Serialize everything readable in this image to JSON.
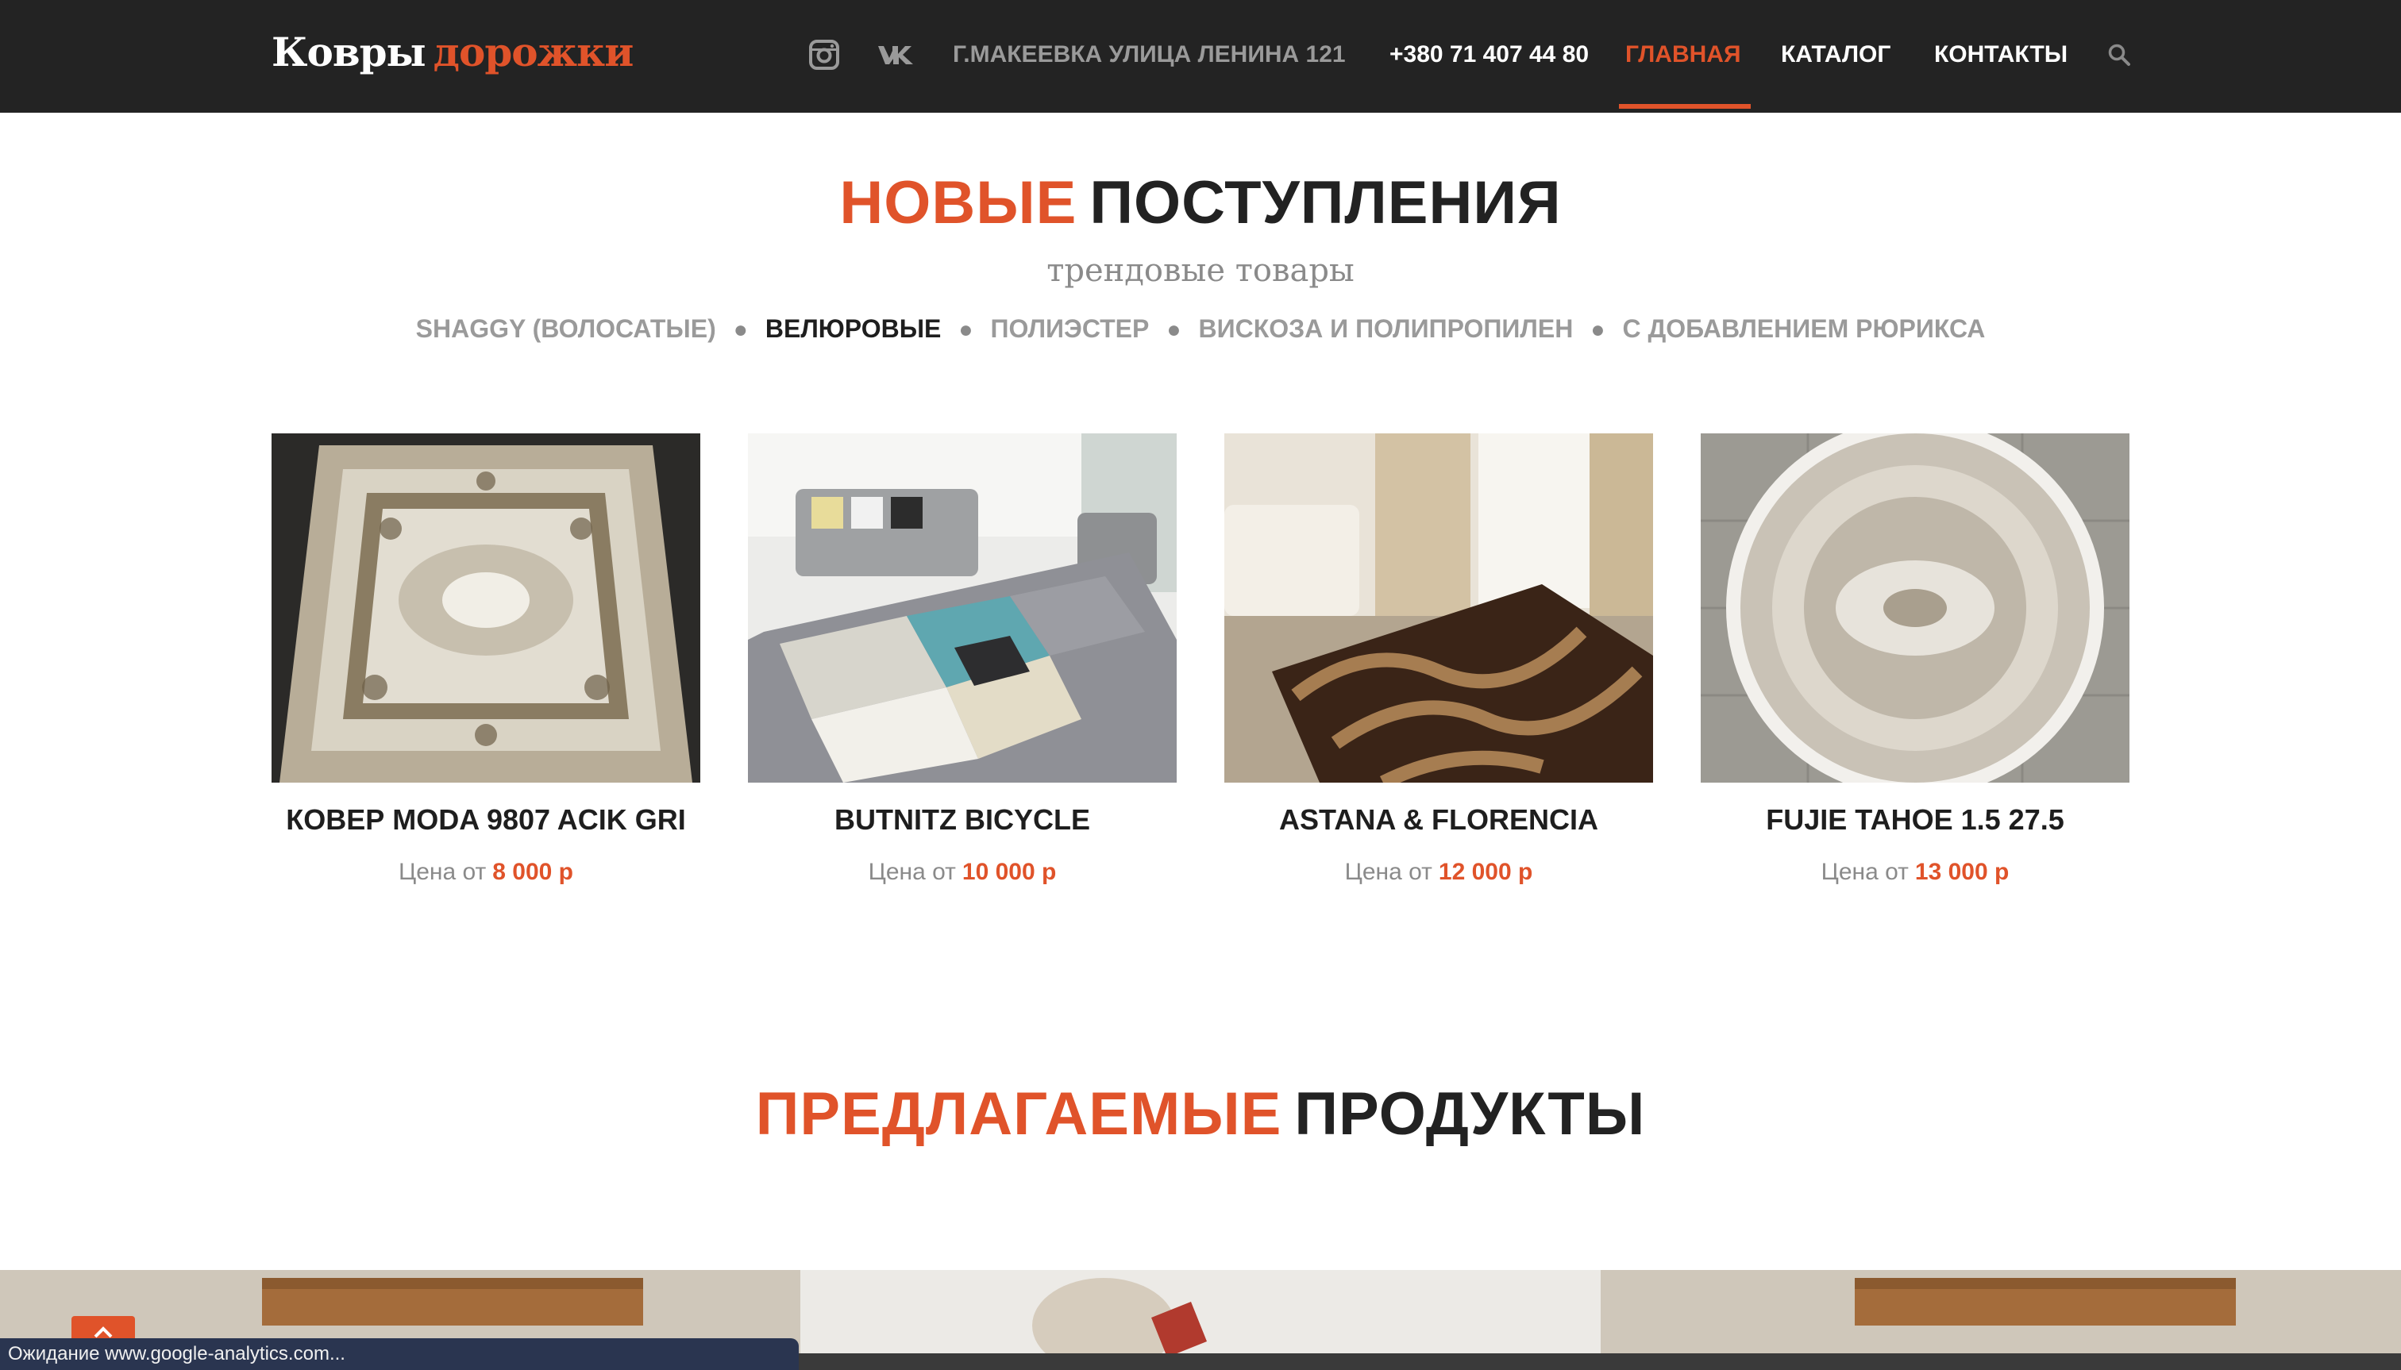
{
  "header": {
    "logo_word1": "Ковры",
    "logo_word2": "дорожки",
    "icons": [
      "instagram-icon",
      "vk-icon",
      "search-icon"
    ],
    "address": "Г.МАКЕЕВКА УЛИЦА ЛЕНИНА 121",
    "phone": "+380 71 407 44 80",
    "menu": [
      {
        "label": "ГЛАВНАЯ",
        "active": true
      },
      {
        "label": "КАТАЛОГ",
        "active": false
      },
      {
        "label": "КОНТАКТЫ",
        "active": false
      }
    ]
  },
  "new_arrivals": {
    "title_accent": "НОВЫЕ",
    "title_rest": "ПОСТУПЛЕНИЯ",
    "subtitle": "трендовые товары",
    "filters": [
      {
        "label": "SHAGGY (ВОЛОСАТЫЕ)",
        "active": false
      },
      {
        "label": "ВЕЛЮРОВЫЕ",
        "active": true
      },
      {
        "label": "ПОЛИЭСТЕР",
        "active": false
      },
      {
        "label": "ВИСКОЗА И ПОЛИПРОПИЛЕН",
        "active": false
      },
      {
        "label": "С ДОБАВЛЕНИЕМ РЮРИКСА",
        "active": false
      }
    ],
    "products": [
      {
        "name": "КОВЕР MODA 9807 ACIK GRI",
        "price_prefix": "Цена от",
        "price": "8 000 р"
      },
      {
        "name": "BUTNITZ BICYCLE",
        "price_prefix": "Цена от",
        "price": "10 000 р"
      },
      {
        "name": "ASTANA & FLORENCIA",
        "price_prefix": "Цена от",
        "price": "12 000 р"
      },
      {
        "name": "FUJIE TAHOE 1.5 27.5",
        "price_prefix": "Цена от",
        "price": "13 000 р"
      }
    ]
  },
  "featured": {
    "title_accent": "ПРЕДЛАГАЕМЫЕ",
    "title_rest": "ПРОДУКТЫ"
  },
  "status_bar": {
    "text": "Ожидание www.google-analytics.com..."
  },
  "colors": {
    "accent": "#e0532a",
    "header_bg": "#232323",
    "status_bar_bg": "#2a3550"
  }
}
